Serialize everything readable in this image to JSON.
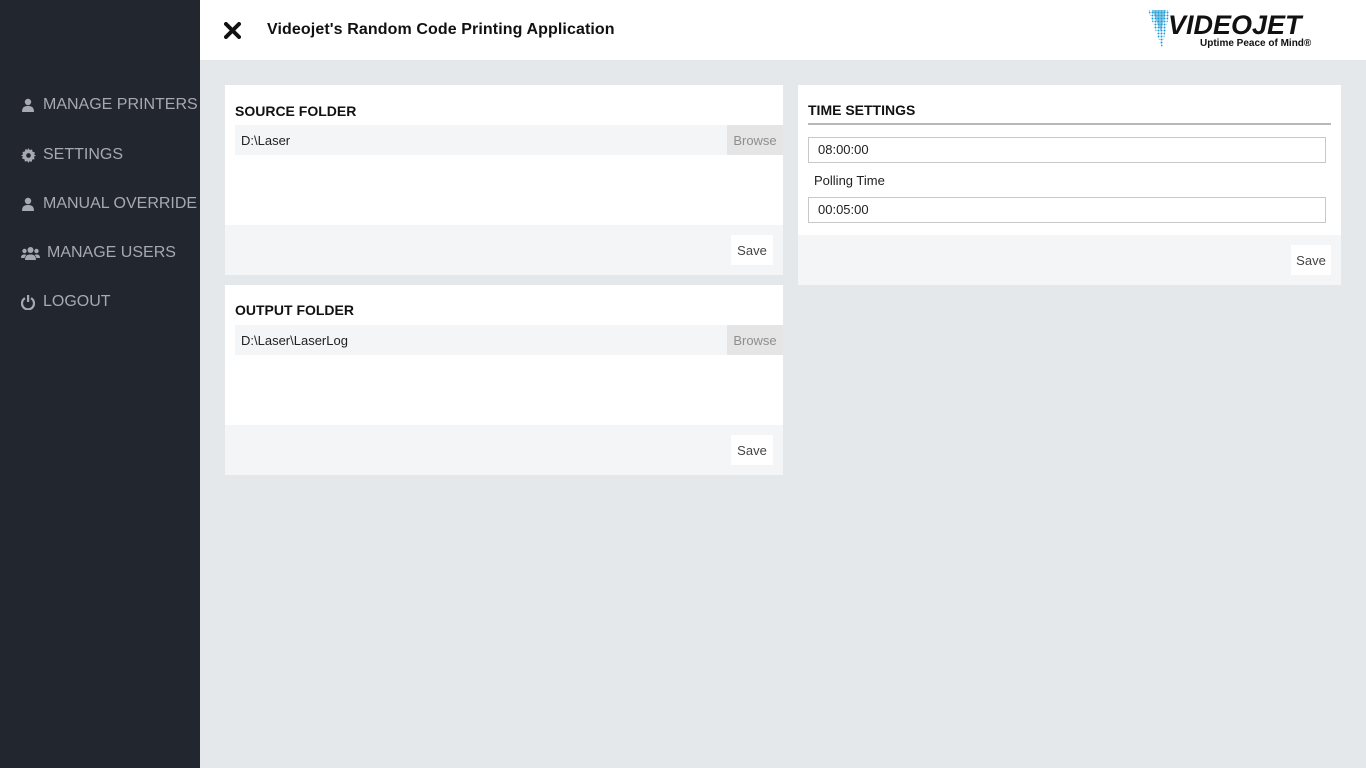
{
  "sidebar": {
    "items": [
      {
        "label": "MANAGE PRINTERS",
        "icon": "user-icon"
      },
      {
        "label": "SETTINGS",
        "icon": "gear-icon"
      },
      {
        "label": "MANUAL OVERRIDE",
        "icon": "user-icon"
      },
      {
        "label": "MANAGE USERS",
        "icon": "users-icon"
      },
      {
        "label": "LOGOUT",
        "icon": "power-icon"
      }
    ]
  },
  "header": {
    "title": "Videojet's Random Code Printing Application",
    "logo_text": "VIDEOJET",
    "logo_tagline": "Uptime Peace of Mind®"
  },
  "source_folder": {
    "title": "SOURCE FOLDER",
    "path": "D:\\Laser",
    "browse_label": "Browse",
    "save_label": "Save"
  },
  "output_folder": {
    "title": "OUTPUT FOLDER",
    "path": "D:\\Laser\\LaserLog",
    "browse_label": "Browse",
    "save_label": "Save"
  },
  "time_settings": {
    "title": "TIME SETTINGS",
    "time_value": "08:00:00",
    "polling_label": "Polling Time",
    "polling_value": "00:05:00",
    "save_label": "Save"
  },
  "colors": {
    "sidebar_bg": "#22262f",
    "content_bg": "#e5e8eb",
    "logo_accent": "#1b9ad6"
  }
}
